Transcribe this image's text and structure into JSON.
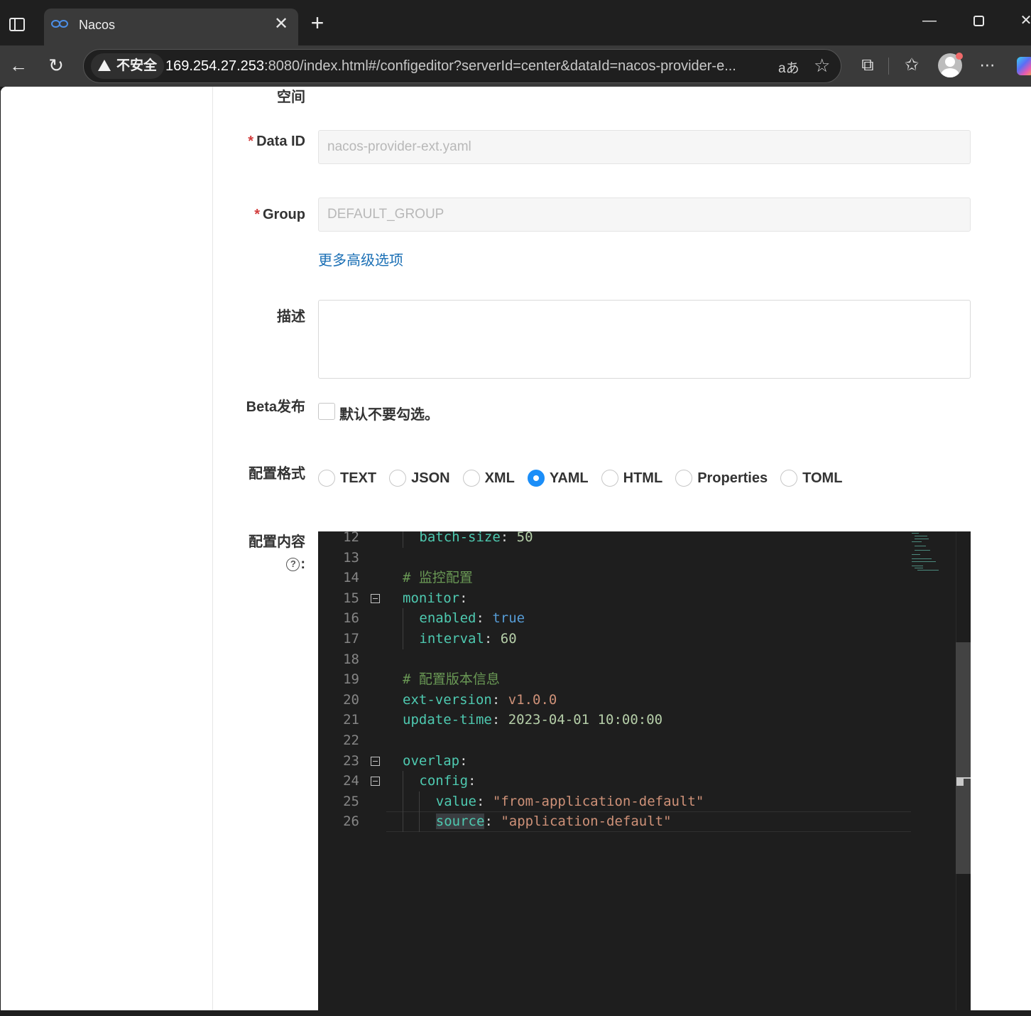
{
  "browser": {
    "tab_title": "Nacos",
    "url_host": "169.254.27.253",
    "url_rest": ":8080/index.html#/configeditor?serverId=center&dataId=nacos-provider-e...",
    "security_label": "不安全",
    "read_aloud": "aあ"
  },
  "form": {
    "namespace_label": "空间",
    "data_id_label": "Data ID",
    "data_id_value": "nacos-provider-ext.yaml",
    "group_label": "Group",
    "group_value": "DEFAULT_GROUP",
    "advanced_link": "更多高级选项",
    "desc_label": "描述",
    "beta_label": "Beta发布",
    "beta_checkbox_label": "默认不要勾选。",
    "format_label": "配置格式",
    "formats": [
      "TEXT",
      "JSON",
      "XML",
      "YAML",
      "HTML",
      "Properties",
      "TOML"
    ],
    "selected_format": "YAML",
    "content_label_a": "配置内",
    "content_label_b": "容",
    "content_label_c": ":",
    "help_glyph": "?"
  },
  "editor": {
    "lines": [
      {
        "no": "12",
        "indent": 1,
        "key": "batch-size",
        "value": "50",
        "vtype": "n"
      },
      {
        "no": "13"
      },
      {
        "no": "14",
        "indent": 0,
        "comment": "# 监控配置"
      },
      {
        "no": "15",
        "indent": 0,
        "key": "monitor",
        "fold": true
      },
      {
        "no": "16",
        "indent": 1,
        "key": "enabled",
        "value": "true",
        "vtype": "b"
      },
      {
        "no": "17",
        "indent": 1,
        "key": "interval",
        "value": "60",
        "vtype": "n"
      },
      {
        "no": "18"
      },
      {
        "no": "19",
        "indent": 0,
        "comment": "# 配置版本信息"
      },
      {
        "no": "20",
        "indent": 0,
        "key": "ext-version",
        "value": "v1.0.0",
        "vtype": "s"
      },
      {
        "no": "21",
        "indent": 0,
        "key": "update-time",
        "value": "2023-04-01 10:00:00",
        "vtype": "n"
      },
      {
        "no": "22"
      },
      {
        "no": "23",
        "indent": 0,
        "key": "overlap",
        "fold": true
      },
      {
        "no": "24",
        "indent": 1,
        "key": "config",
        "fold": true
      },
      {
        "no": "25",
        "indent": 2,
        "key": "value",
        "value": "\"from-application-default\"",
        "vtype": "s"
      },
      {
        "no": "26",
        "indent": 2,
        "key": "source",
        "value": "\"application-default\"",
        "vtype": "s",
        "current": true
      }
    ]
  }
}
